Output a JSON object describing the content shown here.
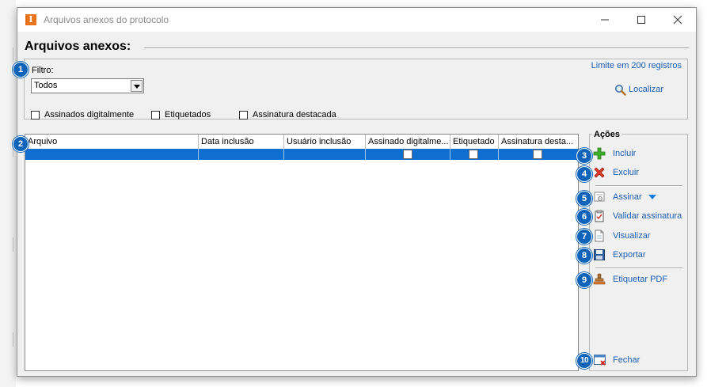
{
  "window": {
    "title": "Arquivos anexos do protocolo",
    "app_icon_letter": "I",
    "minimize": "minimize-icon",
    "maximize": "maximize-icon",
    "close": "close-icon"
  },
  "heading": "Arquivos anexos:",
  "filter": {
    "limit_text": "Limite em 200 registros",
    "label": "Filtro:",
    "selected": "Todos",
    "checkboxes": [
      {
        "label": "Assinados digitalmente",
        "checked": false
      },
      {
        "label": "Etiquetados",
        "checked": false
      },
      {
        "label": "Assinatura destacada",
        "checked": false
      }
    ],
    "locate_label": "Localizar"
  },
  "grid": {
    "columns": [
      "Arquivo",
      "Data inclusão",
      "Usuário inclusão",
      "Assinado digitalme...",
      "Etiquetado",
      "Assinatura desta..."
    ],
    "selected_row": {
      "arquivo": "",
      "data": "",
      "usuario": "",
      "assinado": false,
      "etiquetado": false,
      "assinatura_destacada": false
    }
  },
  "actions": {
    "title": "Ações",
    "items": {
      "incluir": "Incluir",
      "excluir": "Excluir",
      "assinar": "Assinar",
      "validar": "Validar assinatura",
      "visualizar": "Visualizar",
      "exportar": "Exportar",
      "etiquetar": "Etiquetar PDF",
      "fechar": "Fechar"
    }
  },
  "badges": [
    "1",
    "2",
    "3",
    "4",
    "5",
    "6",
    "7",
    "8",
    "9",
    "10"
  ],
  "colors": {
    "accent": "#1a5fb4",
    "selection": "#0f6fd1",
    "badge": "#0f63b8",
    "app_icon": "#e8731a"
  }
}
